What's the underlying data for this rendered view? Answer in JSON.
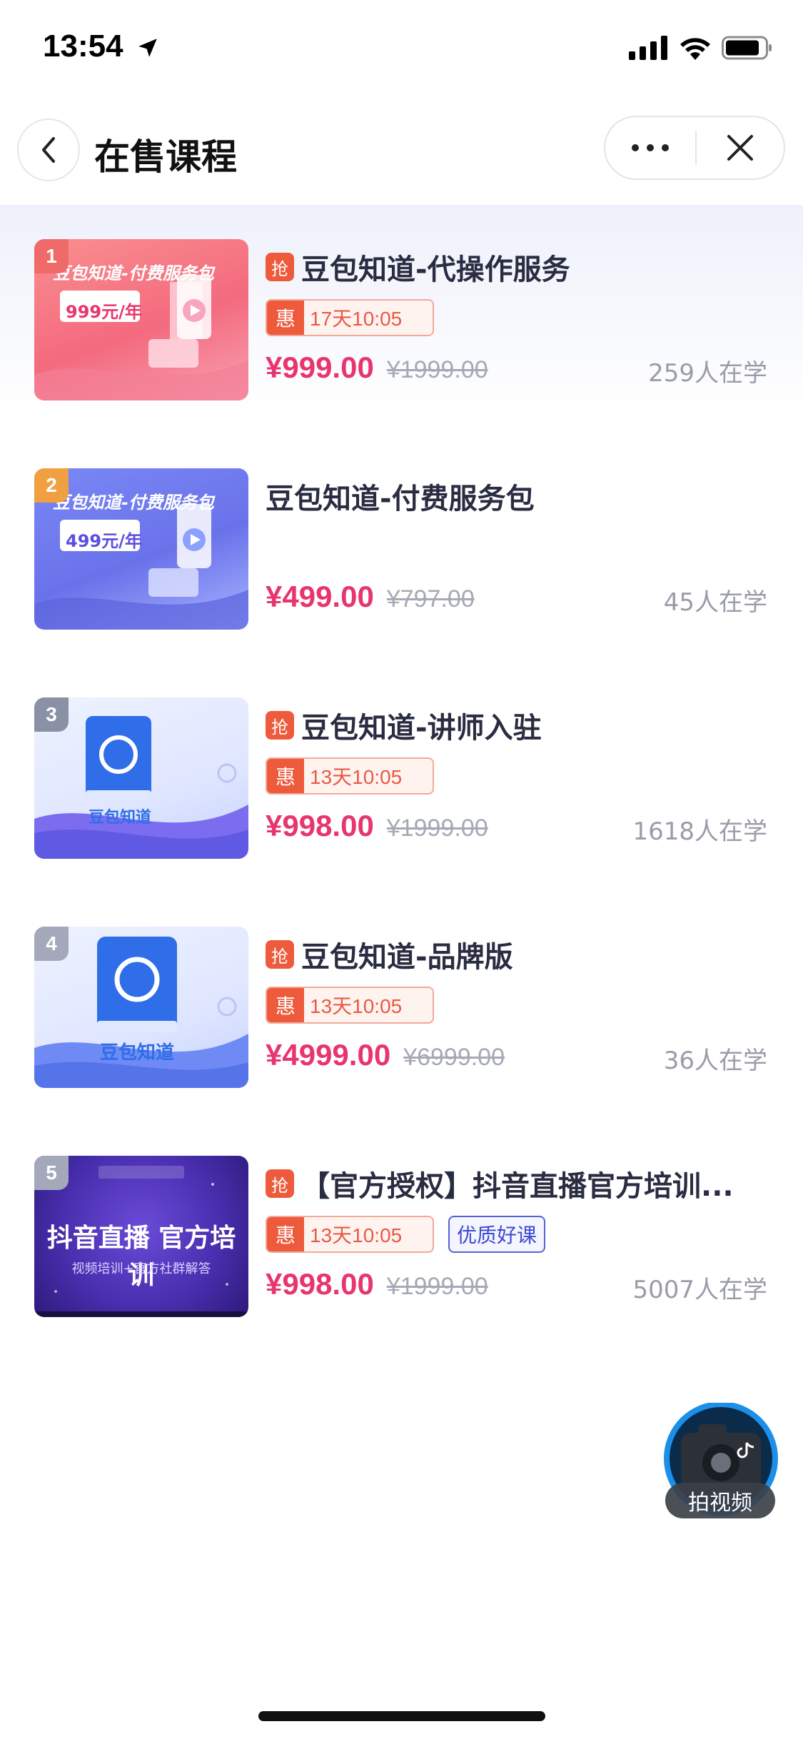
{
  "status_bar": {
    "time": "13:54"
  },
  "nav": {
    "title": "在售课程"
  },
  "courses": [
    {
      "rank": "1",
      "rank_color": "#f06a6a",
      "theme": "pink",
      "thumb_title": "豆包知道-付费服务包",
      "thumb_price": "999元/年",
      "rush": "抢",
      "title": "豆包知道-代操作服务",
      "discount_mark": "惠",
      "countdown": "17天10:05",
      "price": "¥999.00",
      "original_price": "¥1999.00",
      "learners": "259人在学"
    },
    {
      "rank": "2",
      "rank_color": "#f0a040",
      "theme": "purple",
      "thumb_title": "豆包知道-付费服务包",
      "thumb_price": "499元/年",
      "title": "豆包知道-付费服务包",
      "price": "¥499.00",
      "original_price": "¥797.00",
      "learners": "45人在学"
    },
    {
      "rank": "3",
      "rank_color": "#8a90a6",
      "theme": "book",
      "thumb_brand": "豆包知道",
      "rush": "抢",
      "title": "豆包知道-讲师入驻",
      "discount_mark": "惠",
      "countdown": "13天10:05",
      "price": "¥998.00",
      "original_price": "¥1999.00",
      "learners": "1618人在学"
    },
    {
      "rank": "4",
      "rank_color": "#a3a8ba",
      "theme": "book",
      "thumb_brand": "豆包知道",
      "rush": "抢",
      "title": "豆包知道-品牌版",
      "discount_mark": "惠",
      "countdown": "13天10:05",
      "price": "¥4999.00",
      "original_price": "¥6999.00",
      "learners": "36人在学"
    },
    {
      "rank": "5",
      "rank_color": "#a3a8ba",
      "theme": "douyin",
      "thumb_title": "抖音直播 官方培训",
      "thumb_sub": "视频培训+官方社群解答",
      "rush": "抢",
      "title": "【官方授权】抖音直播官方培训...",
      "discount_mark": "惠",
      "countdown": "13天10:05",
      "badge": "优质好课",
      "price": "¥998.00",
      "original_price": "¥1999.00",
      "learners": "5007人在学"
    }
  ],
  "fab": {
    "label": "拍视频"
  }
}
